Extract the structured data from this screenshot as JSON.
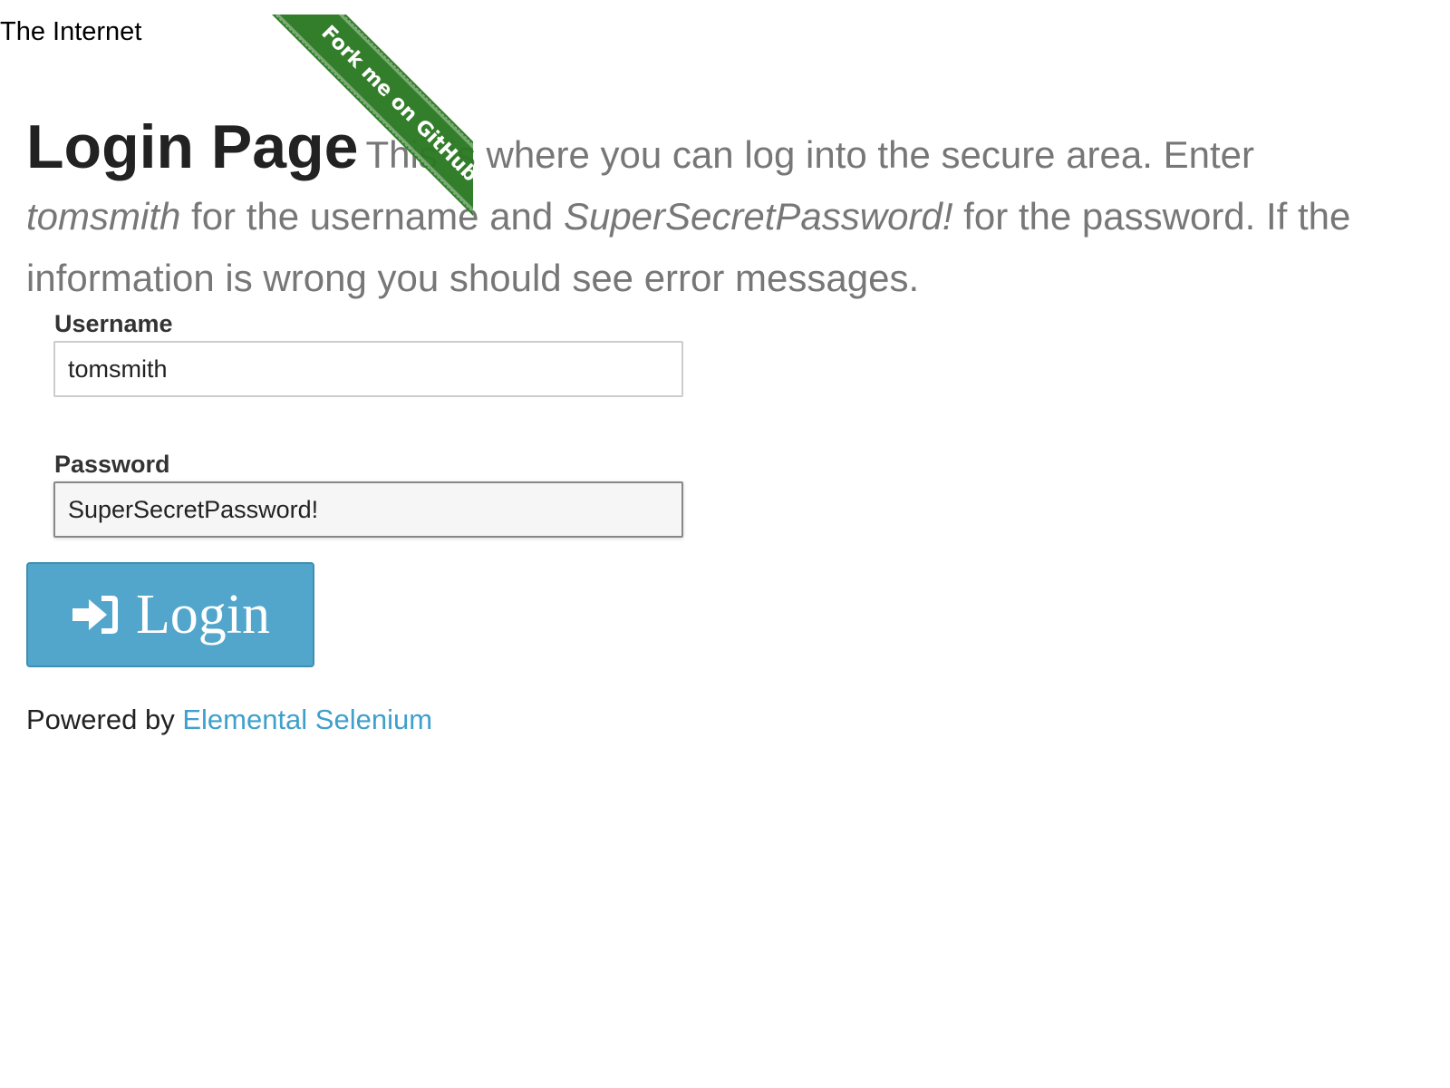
{
  "site": {
    "title": "The Internet"
  },
  "ribbon": {
    "label": "Fork me on GitHub",
    "color": "#2d7a24"
  },
  "login": {
    "heading": "Login Page",
    "intro_part1": "This is where you can log into the secure area. Enter ",
    "intro_username": "tomsmith",
    "intro_part2": " for the username and ",
    "intro_password": "SuperSecretPassword!",
    "intro_part3": " for the password. If the information is wrong you should see error messages.",
    "username_label": "Username",
    "username_value": "tomsmith",
    "password_label": "Password",
    "password_value": "SuperSecretPassword!",
    "button_label": "Login",
    "button_icon": "sign-in-icon",
    "button_color": "#53a6cb"
  },
  "footer": {
    "prefix": "Powered by ",
    "link_text": "Elemental Selenium",
    "link_color": "#3fa0cb"
  }
}
